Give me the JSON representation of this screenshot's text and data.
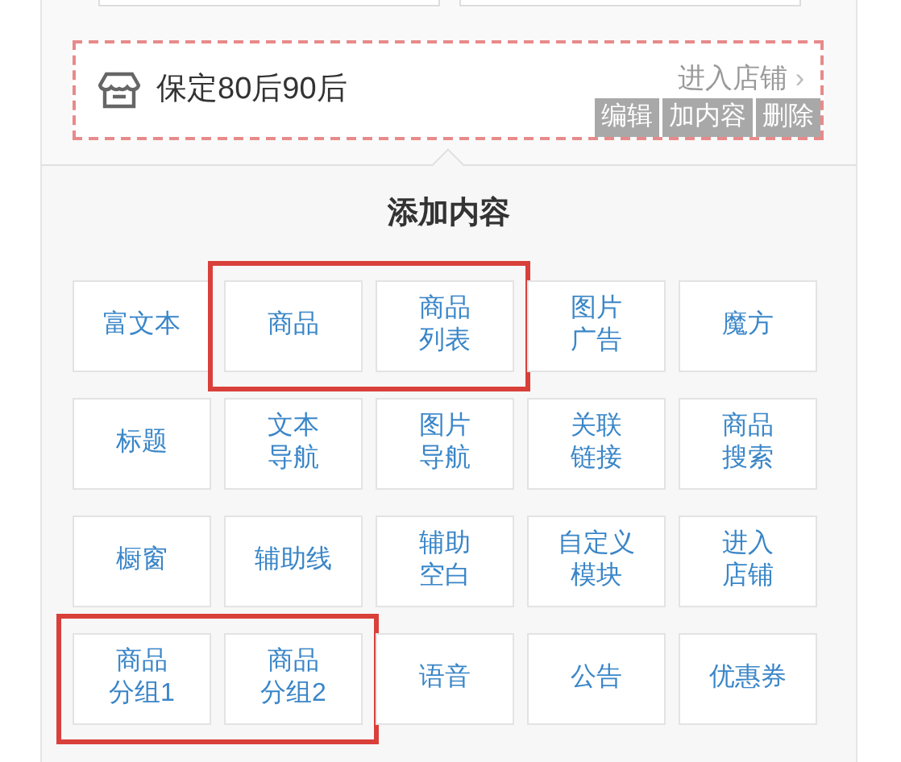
{
  "store_card": {
    "name": "保定80后90后",
    "link": "进入店铺",
    "link_arrow": "›",
    "actions": [
      "编辑",
      "加内容",
      "删除"
    ]
  },
  "add_panel": {
    "title": "添加内容",
    "rows": [
      {
        "groups": [
          {
            "highlighted": false,
            "items": [
              {
                "lines": [
                  "富文本"
                ]
              }
            ]
          },
          {
            "highlighted": true,
            "items": [
              {
                "lines": [
                  "商品"
                ]
              },
              {
                "lines": [
                  "商品",
                  "列表"
                ]
              }
            ]
          },
          {
            "highlighted": false,
            "items": [
              {
                "lines": [
                  "图片",
                  "广告"
                ]
              },
              {
                "lines": [
                  "魔方"
                ]
              }
            ]
          }
        ]
      },
      {
        "groups": [
          {
            "highlighted": false,
            "items": [
              {
                "lines": [
                  "标题"
                ]
              },
              {
                "lines": [
                  "文本",
                  "导航"
                ]
              },
              {
                "lines": [
                  "图片",
                  "导航"
                ]
              },
              {
                "lines": [
                  "关联",
                  "链接"
                ]
              },
              {
                "lines": [
                  "商品",
                  "搜索"
                ]
              }
            ]
          }
        ]
      },
      {
        "groups": [
          {
            "highlighted": false,
            "items": [
              {
                "lines": [
                  "橱窗"
                ]
              },
              {
                "lines": [
                  "辅助线"
                ]
              },
              {
                "lines": [
                  "辅助",
                  "空白"
                ]
              },
              {
                "lines": [
                  "自定义",
                  "模块"
                ]
              },
              {
                "lines": [
                  "进入",
                  "店铺"
                ]
              }
            ]
          }
        ]
      },
      {
        "groups": [
          {
            "highlighted": true,
            "items": [
              {
                "lines": [
                  "商品",
                  "分组1"
                ]
              },
              {
                "lines": [
                  "商品",
                  "分组2"
                ]
              }
            ]
          },
          {
            "highlighted": false,
            "items": [
              {
                "lines": [
                  "语音"
                ]
              },
              {
                "lines": [
                  "公告"
                ]
              },
              {
                "lines": [
                  "优惠券"
                ]
              }
            ]
          }
        ]
      }
    ]
  }
}
